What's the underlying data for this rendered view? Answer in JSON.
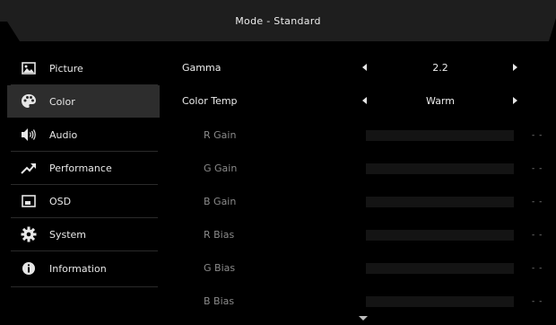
{
  "header": {
    "title": "Mode - Standard"
  },
  "sidebar": {
    "items": [
      {
        "label": "Picture",
        "icon": "picture-icon"
      },
      {
        "label": "Color",
        "icon": "palette-icon",
        "selected": true
      },
      {
        "label": "Audio",
        "icon": "speaker-icon"
      },
      {
        "label": "Performance",
        "icon": "trend-arrow-icon"
      },
      {
        "label": "OSD",
        "icon": "osd-window-icon"
      },
      {
        "label": "System",
        "icon": "gear-icon"
      },
      {
        "label": "Information",
        "icon": "info-icon"
      }
    ]
  },
  "color_menu": {
    "gamma": {
      "label": "Gamma",
      "value": "2.2"
    },
    "color_temp": {
      "label": "Color Temp",
      "value": "Warm"
    },
    "gains": [
      {
        "label": "R Gain",
        "value": "- -"
      },
      {
        "label": "G Gain",
        "value": "- -"
      },
      {
        "label": "B Gain",
        "value": "- -"
      },
      {
        "label": "R Bias",
        "value": "- -"
      },
      {
        "label": "G Bias",
        "value": "- -"
      },
      {
        "label": "B Bias",
        "value": "- -"
      }
    ]
  },
  "colors": {
    "background": "#000000",
    "header_bar": "#1e1e1e",
    "selected_row": "#2d2d2d",
    "text": "#e6e6e6",
    "disabled_text": "#8a8a8a"
  }
}
